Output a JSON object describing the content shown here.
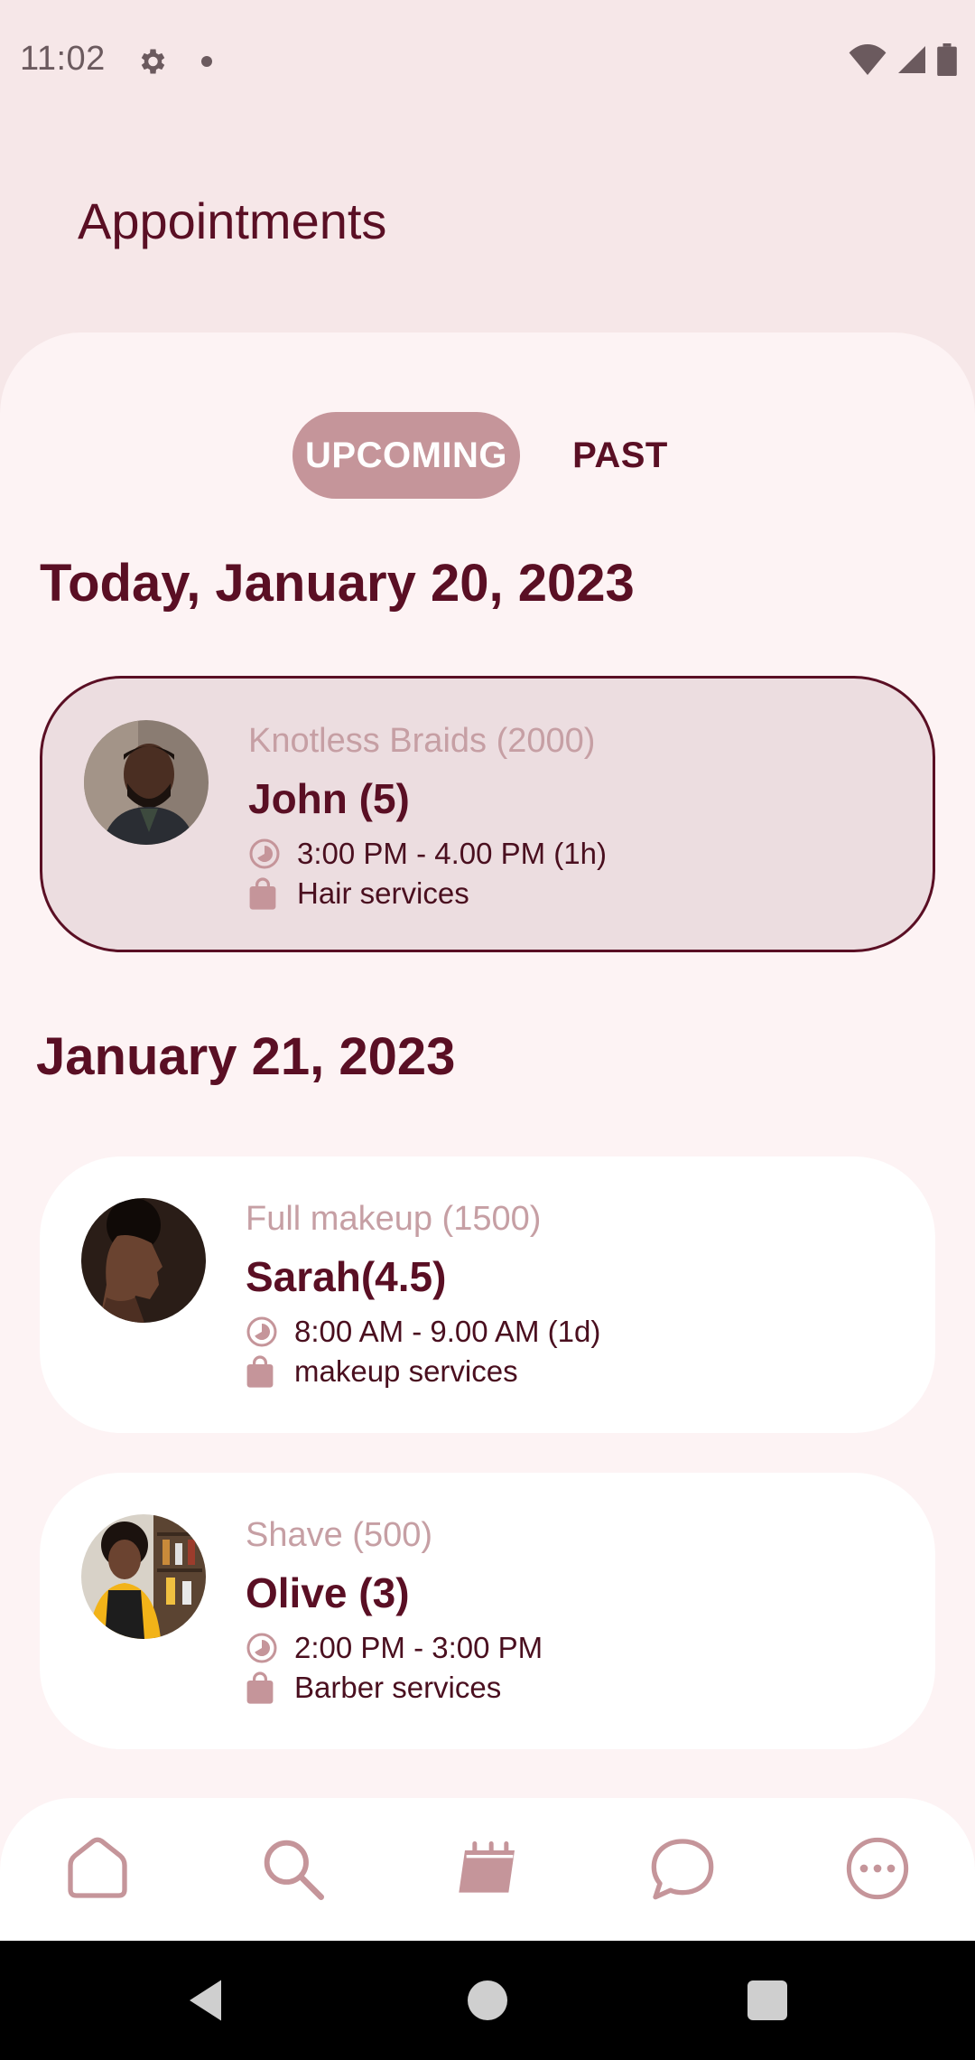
{
  "status_bar": {
    "time": "11:02"
  },
  "header": {
    "title": "Appointments"
  },
  "tabs": [
    {
      "label": "UPCOMING",
      "active": true
    },
    {
      "label": "PAST",
      "active": false
    }
  ],
  "sections": [
    {
      "date": "Today, January 20, 2023"
    },
    {
      "date": "January 21, 2023"
    }
  ],
  "appointments": [
    {
      "service": "Knotless Braids (2000)",
      "provider": "John  (5)",
      "time": "3:00 PM - 4.00 PM (1h)",
      "category": "Hair services",
      "selected": true
    },
    {
      "service": "Full makeup (1500)",
      "provider": "Sarah(4.5)",
      "time": "8:00 AM - 9.00 AM (1d)",
      "category": "makeup services",
      "selected": false
    },
    {
      "service": "Shave (500)",
      "provider": "Olive (3)",
      "time": "2:00 PM - 3:00 PM",
      "category": "Barber services",
      "selected": false
    }
  ],
  "bottom_nav": [
    "home-icon",
    "search-icon",
    "calendar-icon",
    "chat-icon",
    "more-icon"
  ],
  "colors": {
    "primary": "#5a0f24",
    "accent": "#c5959a",
    "background": "#f6e7e8",
    "sheet": "#fdf3f4"
  }
}
